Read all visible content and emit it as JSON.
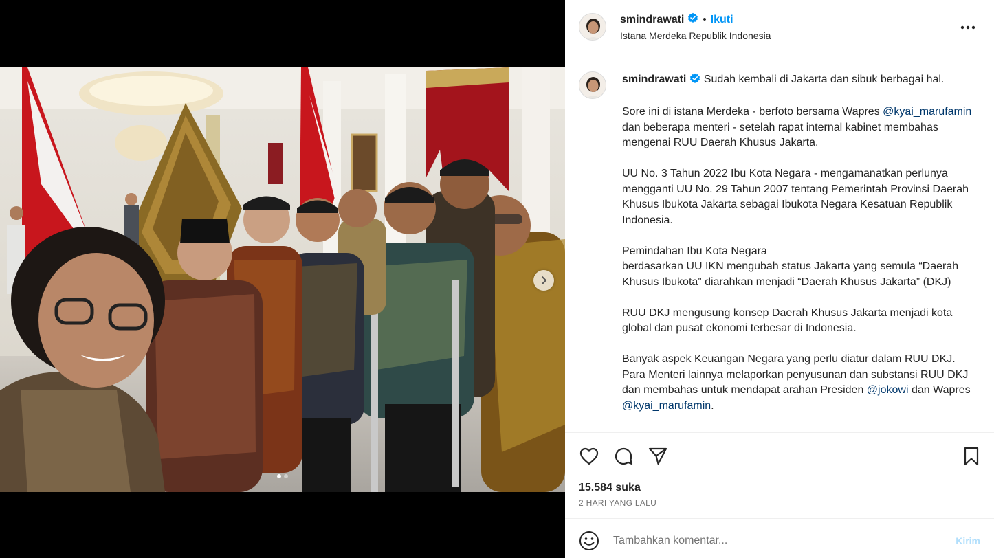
{
  "post": {
    "username": "smindrawati",
    "separator": "•",
    "follow_label": "Ikuti",
    "location": "Istana Merdeka Republik Indonesia",
    "more_icon": "more-horizontal-icon",
    "verified_icon": "verified-badge-icon"
  },
  "caption": {
    "username": "smindrawati",
    "paragraphs": [
      [
        {
          "text": "Sudah kembali di Jakarta dan sibuk berbagai hal."
        }
      ],
      [
        {
          "text": "Sore ini di istana Merdeka - berfoto bersama Wapres "
        },
        {
          "text": "@kyai_marufamin",
          "mention": true
        },
        {
          "text": " dan beberapa menteri - setelah rapat internal kabinet membahas mengenai RUU Daerah Khusus Jakarta."
        }
      ],
      [
        {
          "text": "UU No. 3 Tahun 2022 Ibu Kota Negara - mengamanatkan perlunya mengganti UU No. 29 Tahun 2007 tentang Pemerintah Provinsi Daerah Khusus Ibukota Jakarta sebagai Ibukota Negara Kesatuan Republik Indonesia."
        }
      ],
      [
        {
          "text": "Pemindahan Ibu Kota Negara"
        },
        {
          "br": true
        },
        {
          "text": "berdasarkan UU IKN mengubah status Jakarta yang semula “Daerah Khusus Ibukota” diarahkan menjadi “Daerah Khusus Jakarta” (DKJ)"
        }
      ],
      [
        {
          "text": "RUU DKJ mengusung konsep Daerah Khusus Jakarta menjadi kota global dan pusat ekonomi terbesar di Indonesia."
        }
      ],
      [
        {
          "text": "Banyak aspek Keuangan Negara yang perlu diatur dalam RUU DKJ. Para Menteri lainnya melaporkan penyusunan dan substansi RUU DKJ dan membahas untuk mendapat arahan Presiden "
        },
        {
          "text": "@jokowi",
          "mention": true
        },
        {
          "text": " dan Wapres "
        },
        {
          "text": "@kyai_marufamin",
          "mention": true
        },
        {
          "text": "."
        }
      ]
    ]
  },
  "actions": {
    "like_icon": "heart-icon",
    "comment_icon": "comment-bubble-icon",
    "share_icon": "paper-plane-icon",
    "save_icon": "bookmark-icon",
    "likes_text": "15.584 suka",
    "time_text": "2 HARI YANG LALU"
  },
  "comment": {
    "placeholder": "Tambahkan komentar...",
    "post_label": "Kirim",
    "emoji_icon": "emoji-smiley-icon"
  },
  "media": {
    "next_icon": "chevron-right-icon",
    "carousel_total": 2,
    "carousel_active": 1
  },
  "colors": {
    "accent": "#0095f6",
    "mention": "#00376b",
    "post_disabled": "#b2dffc",
    "secondary_text": "#737373"
  }
}
